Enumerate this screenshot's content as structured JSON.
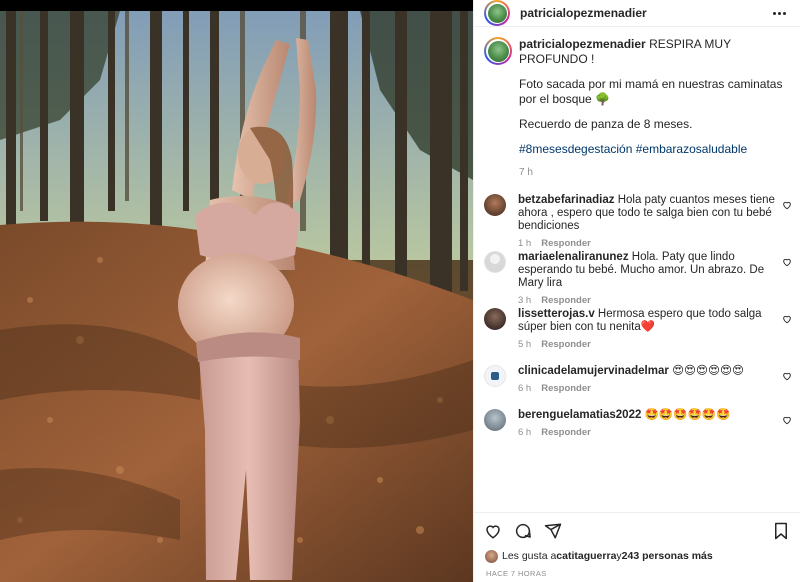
{
  "post": {
    "username": "patricialopezmenadier",
    "caption": {
      "title": "RESPIRA MUY PROFUNDO !",
      "para1": "Foto sacada por mi mamá en nuestras caminatas por el bosque 🌳",
      "para2": "Recuerdo de panza de 8 meses.",
      "hashtags": "#8mesesdegestación #embarazosaludable",
      "time": "7 h"
    }
  },
  "comments": [
    {
      "user": "betzabefarinadiaz",
      "text": "Hola paty cuantos meses tiene ahora , espero que todo te salga bien con tu bebé bendiciones",
      "time": "1 h",
      "reply": "Responder",
      "avatar_color": "#5a3b2a"
    },
    {
      "user": "mariaelenaliranunez",
      "text": "Hola. Paty que lindo esperando tu bebé. Mucho amor. Un abrazo. De Mary lira",
      "time": "3 h",
      "reply": "Responder",
      "avatar_color": "#dcdcdc"
    },
    {
      "user": "lissetterojas.v",
      "text": "Hermosa espero que todo salga súper bien con tu nenita❤️",
      "time": "5 h",
      "reply": "Responder",
      "avatar_color": "#3b2b26"
    },
    {
      "user": "clinicadelamujervinadelmar",
      "text": "😍😍😍😍😍😍",
      "time": "6 h",
      "reply": "Responder",
      "avatar_color": "#e8eef4"
    },
    {
      "user": "berenguelamatias2022",
      "text": "🤩🤩🤩🤩🤩🤩",
      "time": "6 h",
      "reply": "Responder",
      "avatar_color": "#7a8a95"
    }
  ],
  "likes": {
    "prefix": "Les gusta a ",
    "user": "catitaguerra",
    "middle": " y ",
    "count": "243 personas más"
  },
  "posted_ago": "HACE 7 HORAS",
  "icons": {
    "more": "more-options-icon",
    "like": "heart-icon",
    "comment": "comment-icon",
    "share": "share-icon",
    "save": "bookmark-icon"
  }
}
